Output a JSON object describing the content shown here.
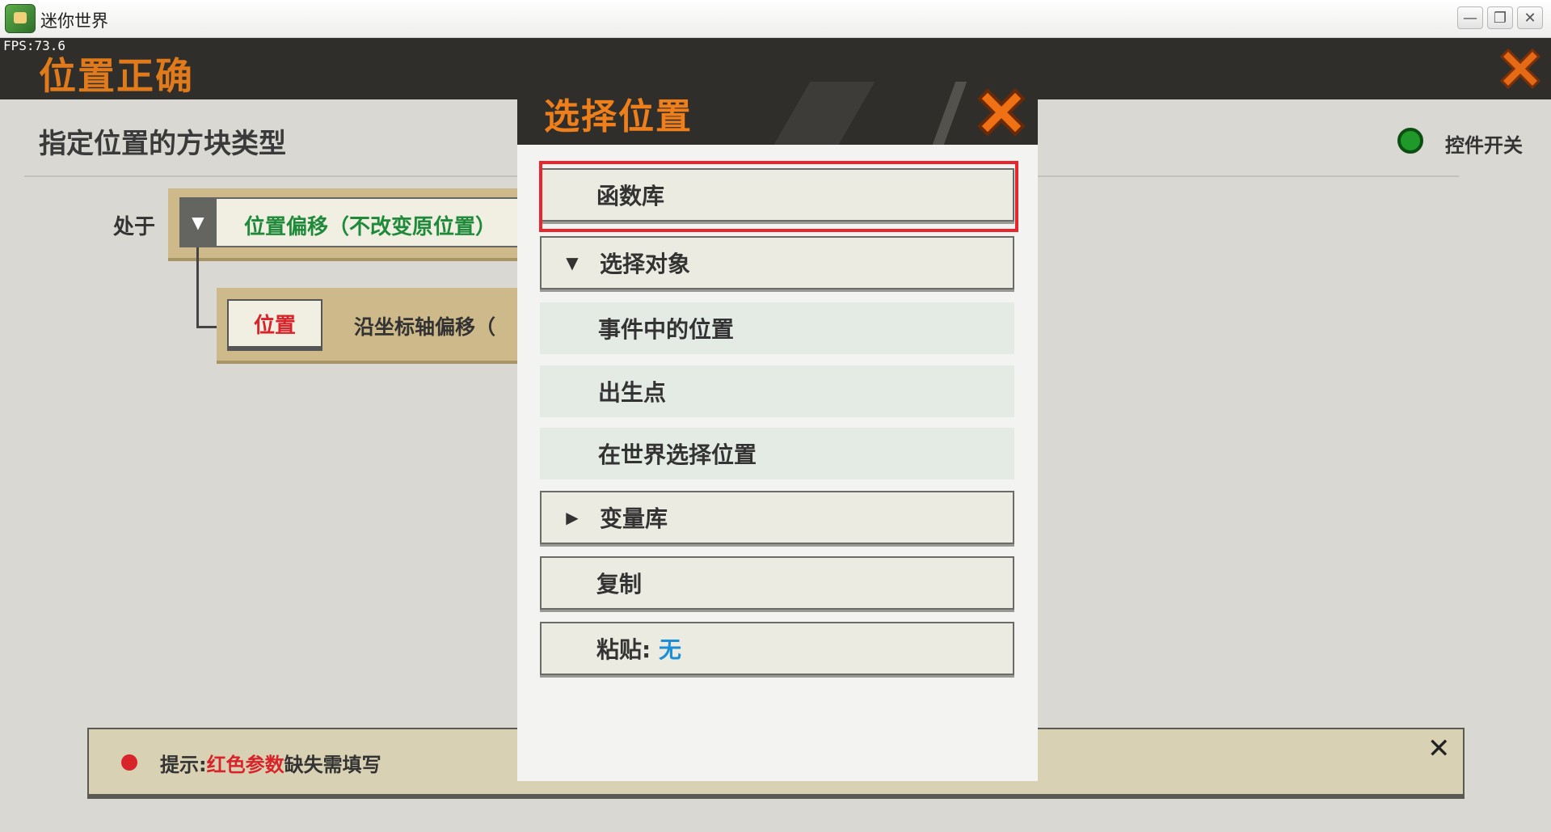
{
  "window": {
    "title": "迷你世界",
    "minimize_glyph": "—",
    "maximize_glyph": "❐",
    "close_glyph": "✕"
  },
  "game": {
    "fps": "FPS:73.6",
    "page_title": "位置正确",
    "section_title": "指定位置的方块类型",
    "toggle_label": "控件开关",
    "row1_label": "处于",
    "row1_dropdown_arrow": "▼",
    "row1_value": "位置偏移（不改变原位置）",
    "row2_chip": "位置",
    "row2_text": "沿坐标轴偏移（",
    "hint_prefix": "提示:",
    "hint_red": "红色参数",
    "hint_suffix": "缺失需填写",
    "hint_close": "✕"
  },
  "modal": {
    "title": "选择位置",
    "items": [
      {
        "label": "函数库",
        "type": "category",
        "expanded": null
      },
      {
        "label": "选择对象",
        "type": "category",
        "arrow": "▼"
      },
      {
        "label": "事件中的位置",
        "type": "sub"
      },
      {
        "label": "出生点",
        "type": "sub"
      },
      {
        "label": "在世界选择位置",
        "type": "sub"
      },
      {
        "label": "变量库",
        "type": "category",
        "arrow": "▶"
      },
      {
        "label": "复制",
        "type": "category"
      },
      {
        "label": "粘贴:",
        "type": "category",
        "value": "无"
      }
    ]
  },
  "colors": {
    "accent_orange": "#ef7f1a",
    "highlight_red": "#e8262c",
    "toggle_green": "#1f9a2a",
    "value_blue": "#1a8fd8"
  }
}
